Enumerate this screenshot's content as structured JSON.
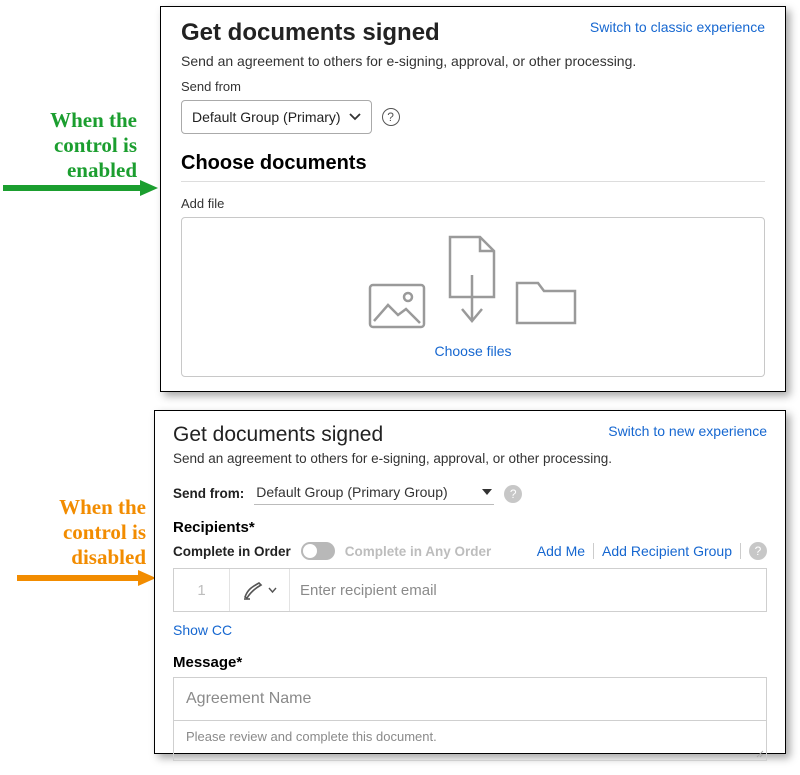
{
  "annotations": {
    "enabled": "When the control is enabled",
    "disabled": "When the control is disabled"
  },
  "panelA": {
    "title": "Get documents signed",
    "switch": "Switch to classic experience",
    "subtitle": "Send an agreement to others for e-signing, approval, or other processing.",
    "send_from_label": "Send from",
    "send_from_value": "Default Group (Primary)",
    "choose_heading": "Choose documents",
    "add_file_label": "Add file",
    "choose_files": "Choose files"
  },
  "panelB": {
    "title": "Get documents signed",
    "switch": "Switch to new experience",
    "subtitle": "Send an agreement to others for e-signing, approval, or other processing.",
    "send_from_label": "Send from:",
    "send_from_value": "Default Group (Primary Group)",
    "recipients_heading": "Recipients*",
    "order_in": "Complete in Order",
    "order_any": "Complete in Any Order",
    "add_me": "Add Me",
    "add_group": "Add Recipient Group",
    "recipient_num": "1",
    "recipient_placeholder": "Enter recipient email",
    "show_cc": "Show CC",
    "message_heading": "Message*",
    "agreement_name_placeholder": "Agreement Name",
    "agreement_body_placeholder": "Please review and complete this document."
  }
}
